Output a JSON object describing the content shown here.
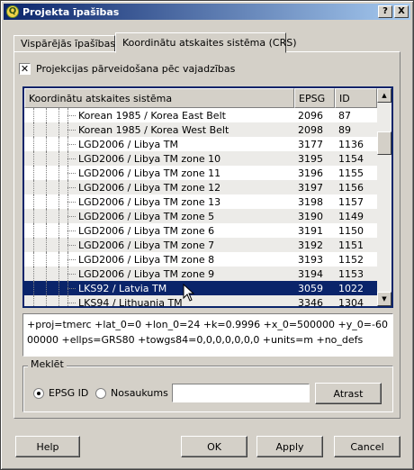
{
  "window": {
    "title": "Projekta īpašības",
    "help_glyph": "?",
    "close_glyph": "X"
  },
  "tabs": [
    {
      "label": "Vispārējās īpašības"
    },
    {
      "label": "Koordinātu atskaites sistēma (CRS)"
    }
  ],
  "crs_panel": {
    "checkbox_label": "Projekcijas pārveidošana pēc vajadzības",
    "checkbox_checked": true,
    "columns": {
      "name": "Koordinātu atskaites sistēma",
      "epsg": "EPSG",
      "id": "ID"
    },
    "rows": [
      {
        "name": "Korean 1985 / Korea East Belt",
        "epsg": "2096",
        "id": "87"
      },
      {
        "name": "Korean 1985 / Korea West Belt",
        "epsg": "2098",
        "id": "89"
      },
      {
        "name": "LGD2006 / Libya TM",
        "epsg": "3177",
        "id": "1136"
      },
      {
        "name": "LGD2006 / Libya TM zone 10",
        "epsg": "3195",
        "id": "1154"
      },
      {
        "name": "LGD2006 / Libya TM zone 11",
        "epsg": "3196",
        "id": "1155"
      },
      {
        "name": "LGD2006 / Libya TM zone 12",
        "epsg": "3197",
        "id": "1156"
      },
      {
        "name": "LGD2006 / Libya TM zone 13",
        "epsg": "3198",
        "id": "1157"
      },
      {
        "name": "LGD2006 / Libya TM zone 5",
        "epsg": "3190",
        "id": "1149"
      },
      {
        "name": "LGD2006 / Libya TM zone 6",
        "epsg": "3191",
        "id": "1150"
      },
      {
        "name": "LGD2006 / Libya TM zone 7",
        "epsg": "3192",
        "id": "1151"
      },
      {
        "name": "LGD2006 / Libya TM zone 8",
        "epsg": "3193",
        "id": "1152"
      },
      {
        "name": "LGD2006 / Libya TM zone 9",
        "epsg": "3194",
        "id": "1153"
      },
      {
        "name": "LKS92 / Latvia TM",
        "epsg": "3059",
        "id": "1022",
        "selected": true
      },
      {
        "name": "LKS94 / Lithuania TM",
        "epsg": "3346",
        "id": "1304"
      }
    ],
    "proj_string": "+proj=tmerc +lat_0=0 +lon_0=24 +k=0.9996 +x_0=500000 +y_0=-6000000 +ellps=GRS80 +towgs84=0,0,0,0,0,0,0 +units=m +no_defs"
  },
  "search": {
    "group_title": "Meklēt",
    "option_epsg": "EPSG ID",
    "option_name": "Nosaukums",
    "selected_option": "EPSG ID",
    "input_value": "",
    "button_label": "Atrast"
  },
  "footer": {
    "help": "Help",
    "ok": "OK",
    "apply": "Apply",
    "cancel": "Cancel"
  }
}
